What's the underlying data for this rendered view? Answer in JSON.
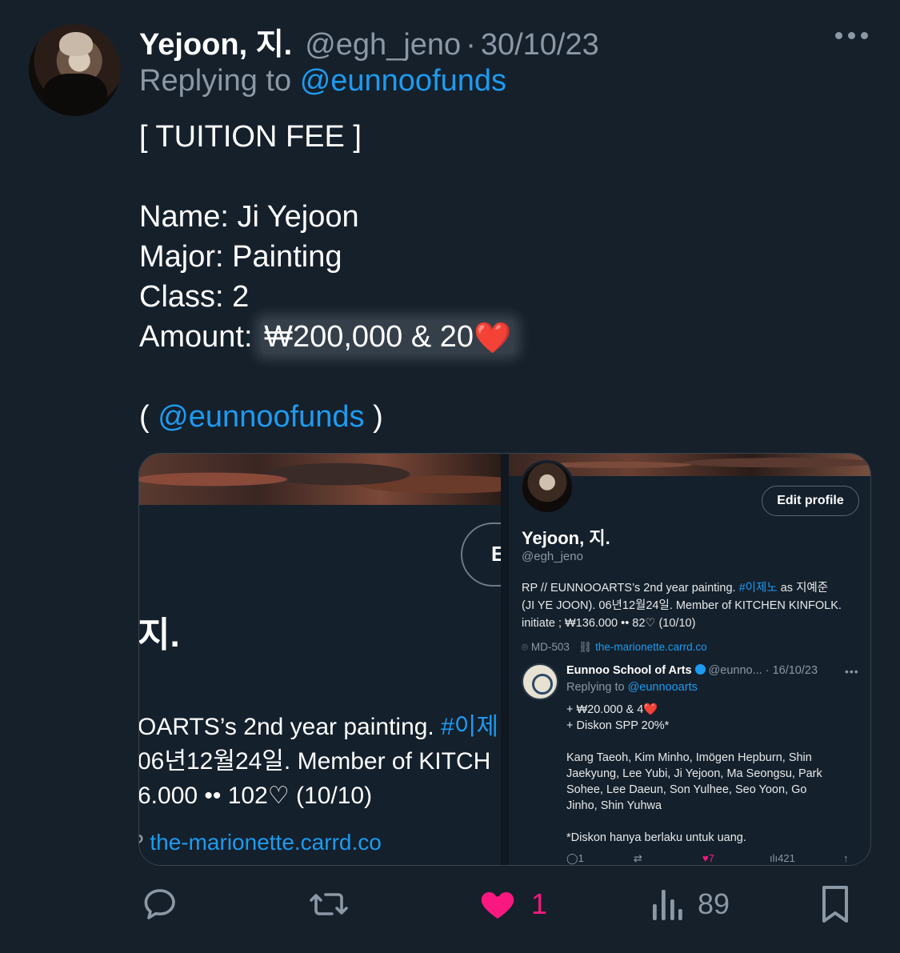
{
  "tweet": {
    "author_name": "Yejoon, 지.",
    "handle": "@egh_jeno",
    "separator": "·",
    "date": "30/10/23",
    "replying_prefix": "Replying to",
    "replying_to": "@eunnoofunds",
    "lines": {
      "title": "[ TUITION FEE ]",
      "name": "Name: Ji Yejoon",
      "major": "Major: Painting",
      "class": "Class: 2",
      "amount_label": "Amount:",
      "amount_value": "₩200,000 & 20",
      "amount_emoji": "❤️",
      "mention_open": "(",
      "mention": "@eunnoofunds",
      "mention_close": ")"
    }
  },
  "media_left": {
    "edit_letter": "E",
    "name_fragment": "지.",
    "bio_line1_prefix": "OARTS’s 2nd year painting.",
    "bio_line1_tag": "#이제",
    "bio_line2": "06년12월24일. Member of KITCH",
    "bio_line3": "6.000 •• 102♡ (10/10)",
    "link_icon": "?",
    "link": "the-marionette.carrd.co"
  },
  "media_right": {
    "edit_profile": "Edit profile",
    "name": "Yejoon, 지.",
    "handle": "@egh_jeno",
    "bio_line1_prefix": "RP // EUNNOOARTS’s 2nd year painting.",
    "bio_line1_tag": "#이제노",
    "bio_line1_suffix": "as 지예준",
    "bio_line2": "(JI YE JOON). 06년12월24일. Member of KITCHEN KINFOLK.",
    "bio_line3": "initiate ; ₩136.000 •• 82♡ (10/10)",
    "location": "MD-503",
    "website": "the-marionette.carrd.co",
    "quoted": {
      "name": "Eunnoo School of Arts",
      "handle": "@eunno...",
      "date": "· 16/10/23",
      "more": "•••",
      "replying_prefix": "Replying to",
      "replying_to": "@eunnooarts",
      "line1": "+ ₩20.000 & 4",
      "line1_emoji": "❤️",
      "line2": "+ Diskon SPP 20%*",
      "names1": "Kang Taeoh, Kim Minho, Imögen Hepburn, Shin",
      "names2": "Jaekyung, Lee Yubi, Ji Yejoon, Ma Seongsu, Park",
      "names3": "Sohee, Lee Daeun, Son Yulhee, Seo Yoon, Go",
      "names4": "Jinho, Shin Yuhwa",
      "note": "*Diskon hanya berlaku untuk uang.",
      "reply_count": "1",
      "like_count": "7",
      "view_count": "421"
    }
  },
  "actions": {
    "reply_icon": "reply-icon",
    "retweet_icon": "retweet-icon",
    "like_icon": "heart-icon",
    "like_count": "1",
    "views_icon": "views-icon",
    "views_count": "89",
    "bookmark_icon": "bookmark-icon"
  },
  "colors": {
    "background": "#15202b",
    "text": "#ffffff",
    "muted": "#8b98a5",
    "link": "#1d9bf0",
    "like": "#f91880"
  }
}
